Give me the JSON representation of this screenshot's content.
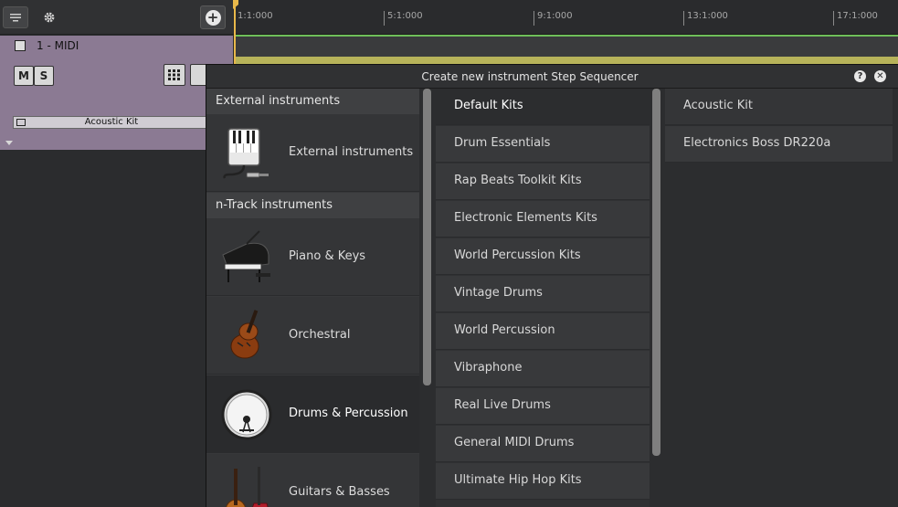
{
  "ruler": {
    "marks": [
      "1:1:000",
      "5:1:000",
      "9:1:000",
      "13:1:000",
      "17:1:000"
    ]
  },
  "track": {
    "name": "1 - MIDI",
    "mute_label": "M",
    "solo_label": "S",
    "instrument": "Acoustic Kit"
  },
  "dialog": {
    "title": "Create new instrument Step Sequencer",
    "help_label": "?",
    "close_label": "✕"
  },
  "categories": {
    "external_header": "External instruments",
    "external_item": "External instruments",
    "ntrack_header": "n-Track instruments",
    "items": [
      {
        "label": "Piano & Keys"
      },
      {
        "label": "Orchestral"
      },
      {
        "label": "Drums & Percussion"
      },
      {
        "label": "Guitars & Basses"
      }
    ]
  },
  "kits": [
    "Default Kits",
    "Drum Essentials",
    "Rap Beats Toolkit Kits",
    "Electronic Elements Kits",
    "World Percussion Kits",
    "Vintage Drums",
    "World Percussion",
    "Vibraphone",
    "Real Live Drums",
    "General MIDI Drums",
    "Ultimate Hip Hop Kits"
  ],
  "presets": [
    "Acoustic Kit",
    "Electronics Boss DR220a"
  ],
  "colors": {
    "accent_playhead": "#e8b84a",
    "track_color": "#8b7a93",
    "clip_color": "#b7b35a"
  }
}
